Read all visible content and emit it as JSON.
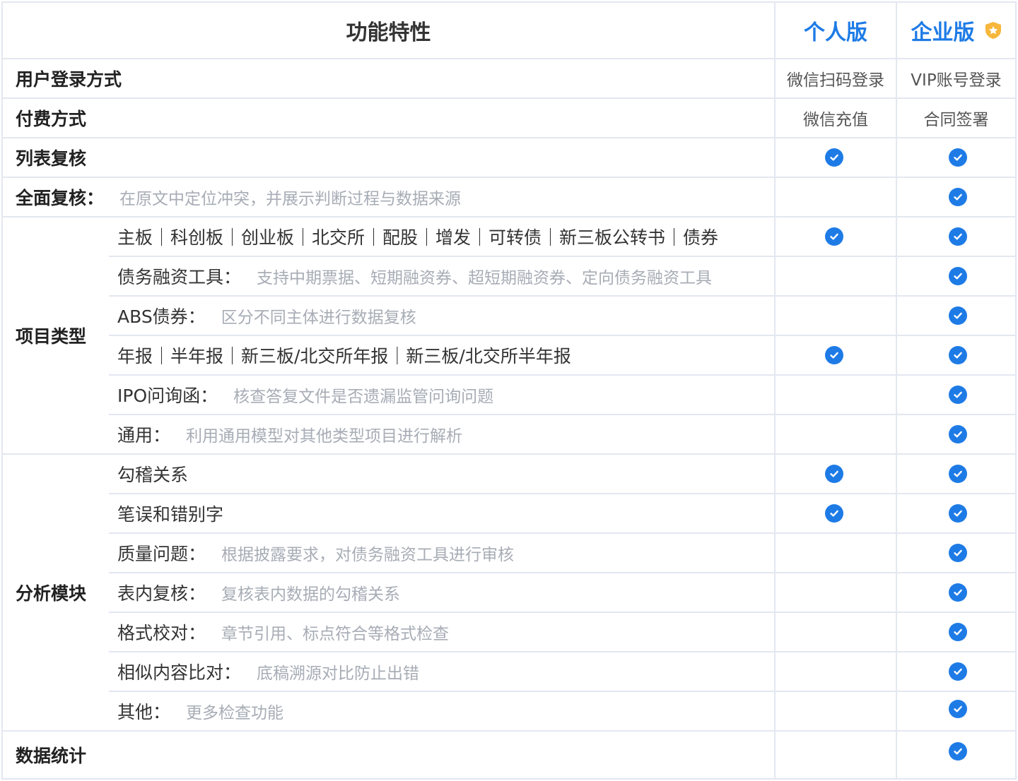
{
  "header": {
    "feature_label": "功能特性",
    "personal_label": "个人版",
    "enterprise_label": "企业版"
  },
  "rows": {
    "login": {
      "label": "用户登录方式",
      "personal": "微信扫码登录",
      "enterprise": "VIP账号登录"
    },
    "payment": {
      "label": "付费方式",
      "personal": "微信充值",
      "enterprise": "合同签署"
    },
    "list_review": {
      "label": "列表复核"
    },
    "full_review": {
      "label": "全面复核：",
      "desc": "在原文中定位冲突，并展示判断过程与数据来源"
    },
    "project_type": {
      "label": "项目类型",
      "items": [
        {
          "label": "主板｜科创板｜创业板｜北交所｜配股｜增发｜可转债｜新三板公转书｜债券",
          "desc": ""
        },
        {
          "label": "债务融资工具：",
          "desc": "支持中期票据、短期融资券、超短期融资券、定向债务融资工具"
        },
        {
          "label": "ABS债券：",
          "desc": "区分不同主体进行数据复核"
        },
        {
          "label": "年报｜半年报｜新三板/北交所年报｜新三板/北交所半年报",
          "desc": ""
        },
        {
          "label": "IPO问询函：",
          "desc": "核查答复文件是否遗漏监管问询问题"
        },
        {
          "label": "通用：",
          "desc": "利用通用模型对其他类型项目进行解析"
        }
      ]
    },
    "analysis": {
      "label": "分析模块",
      "items": [
        {
          "label": "勾稽关系",
          "desc": ""
        },
        {
          "label": "笔误和错别字",
          "desc": ""
        },
        {
          "label": "质量问题：",
          "desc": "根据披露要求，对债务融资工具进行审核"
        },
        {
          "label": "表内复核：",
          "desc": "复核表内数据的勾稽关系"
        },
        {
          "label": "格式校对：",
          "desc": "章节引用、标点符合等格式检查"
        },
        {
          "label": "相似内容比对：",
          "desc": "底稿溯源对比防止出错"
        },
        {
          "label": "其他：",
          "desc": "更多检查功能"
        }
      ]
    },
    "stats": {
      "label": "数据统计"
    }
  },
  "colors": {
    "accent": "#1e7be6",
    "border": "#e3e7f0",
    "muted": "#a7acb5"
  },
  "icons": {
    "check": "check-circle-icon",
    "badge": "shield-star-badge-icon"
  }
}
